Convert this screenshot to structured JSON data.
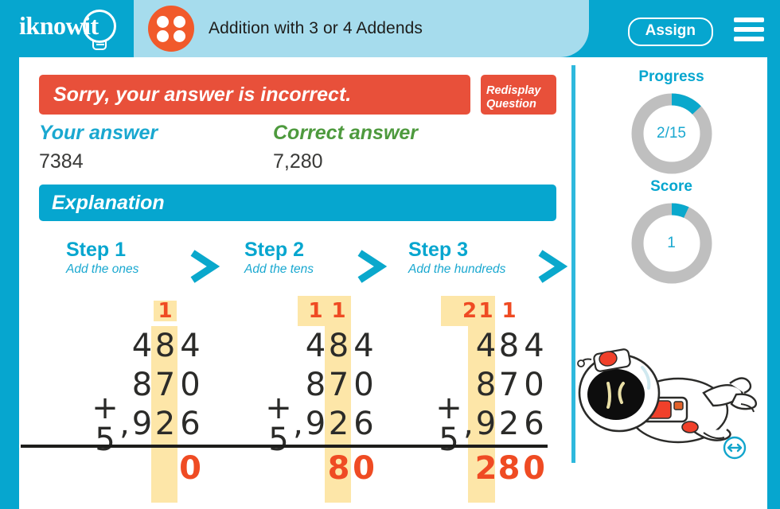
{
  "header": {
    "logo_text": "iknowit",
    "logo_icon": "lightbulb-icon",
    "lesson_title": "Addition with 3 or 4 Addends",
    "lesson_icon": "four-dots-circle-icon",
    "assign_label": "Assign",
    "menu_icon": "hamburger-menu-icon"
  },
  "feedback": {
    "message": "Sorry, your answer is incorrect.",
    "redisplay_label": "Redisplay Question",
    "your_answer_label": "Your answer",
    "your_answer_value": "7384",
    "correct_answer_label": "Correct answer",
    "correct_answer_value": "7,280"
  },
  "explanation": {
    "heading": "Explanation",
    "steps": [
      {
        "title": "Step 1",
        "subtitle": "Add the ones"
      },
      {
        "title": "Step 2",
        "subtitle": "Add the tens"
      },
      {
        "title": "Step 3",
        "subtitle": "Add the hundreds"
      }
    ],
    "chevron_icon": "chevron-right-icon"
  },
  "problem": {
    "addends": [
      "484",
      "870",
      "+ 5,926"
    ],
    "columns": [
      {
        "step": "Step 1",
        "carries": [
          "",
          "",
          "1",
          ""
        ],
        "row1": [
          "",
          "4",
          "8",
          "4"
        ],
        "row2": [
          "",
          "8",
          "7",
          "0"
        ],
        "row3": [
          "+ 5",
          ",",
          "9",
          "2",
          "6"
        ],
        "sum": [
          "",
          "",
          "",
          "0"
        ],
        "highlight_col": "ones",
        "carry_highlight": "tens"
      },
      {
        "step": "Step 2",
        "carries": [
          "",
          "1",
          "1",
          ""
        ],
        "row1": [
          "",
          "4",
          "8",
          "4"
        ],
        "row2": [
          "",
          "8",
          "7",
          "0"
        ],
        "row3": [
          "+ 5",
          ",",
          "9",
          "2",
          "6"
        ],
        "sum": [
          "",
          "",
          "8",
          "0"
        ],
        "highlight_col": "tens",
        "carry_highlight": "hundreds"
      },
      {
        "step": "Step 3",
        "carries": [
          "2",
          "1",
          "1",
          ""
        ],
        "row1": [
          "",
          "4",
          "8",
          "4"
        ],
        "row2": [
          "",
          "8",
          "7",
          "0"
        ],
        "row3": [
          "+ 5",
          ",",
          "9",
          "2",
          "6"
        ],
        "sum": [
          "",
          "2",
          "8",
          "0"
        ],
        "highlight_col": "hundreds",
        "carry_highlight": "thousands"
      }
    ]
  },
  "sidebar": {
    "progress": {
      "label": "Progress",
      "value": "2/15",
      "percent": 13
    },
    "score": {
      "label": "Score",
      "value": "1",
      "percent": 7
    },
    "mascot_icon": "astronaut-mascot",
    "resize_icon": "resize-horizontal-icon"
  },
  "colors": {
    "cyan": "#06a6cf",
    "cyan_light": "#a6dced",
    "orange": "#ef4b23",
    "red": "#e8503a",
    "green": "#4e9a3e",
    "highlight": "#fde6a8",
    "ring_track": "#bfbfbf"
  }
}
